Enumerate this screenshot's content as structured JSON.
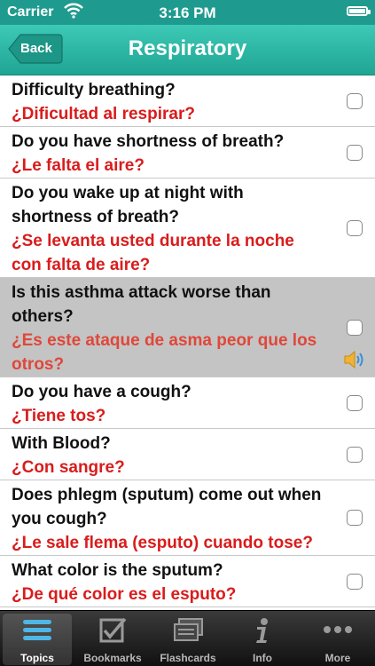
{
  "status_bar": {
    "carrier": "Carrier",
    "time": "3:16 PM"
  },
  "nav": {
    "back_label": "Back",
    "title": "Respiratory"
  },
  "questions": [
    {
      "en": "Difficulty breathing?",
      "es": "¿Dificultad al respirar?",
      "checked": false,
      "selected": false
    },
    {
      "en": "Do you have shortness of breath?",
      "es": "¿Le falta el aire?",
      "checked": false,
      "selected": false
    },
    {
      "en": "Do you wake up at night with shortness of breath?",
      "es": "¿Se levanta usted durante la noche con falta de aire?",
      "checked": false,
      "selected": false
    },
    {
      "en": "Is this asthma attack worse than others?",
      "es": "¿Es este ataque de asma peor que los otros?",
      "checked": false,
      "selected": true
    },
    {
      "en": "Do you have a cough?",
      "es": "¿Tiene tos?",
      "checked": false,
      "selected": false
    },
    {
      "en": "With Blood?",
      "es": "¿Con sangre?",
      "checked": false,
      "selected": false
    },
    {
      "en": "Does phlegm (sputum) come out when you cough?",
      "es": "¿Le sale flema (esputo) cuando tose?",
      "checked": false,
      "selected": false
    },
    {
      "en": "What color is the sputum?",
      "es": "¿De qué color es el esputo?",
      "checked": false,
      "selected": false
    }
  ],
  "tabs": [
    {
      "label": "Topics",
      "icon": "topics-icon",
      "active": true
    },
    {
      "label": "Bookmarks",
      "icon": "bookmarks-icon",
      "active": false
    },
    {
      "label": "Flashcards",
      "icon": "flashcards-icon",
      "active": false
    },
    {
      "label": "Info",
      "icon": "info-icon",
      "active": false
    },
    {
      "label": "More",
      "icon": "more-icon",
      "active": false
    }
  ],
  "colors": {
    "nav_teal": "#2bb5a3",
    "english_text": "#111111",
    "spanish_text": "#d91c1c",
    "selected_row": "#c4c4c4"
  }
}
